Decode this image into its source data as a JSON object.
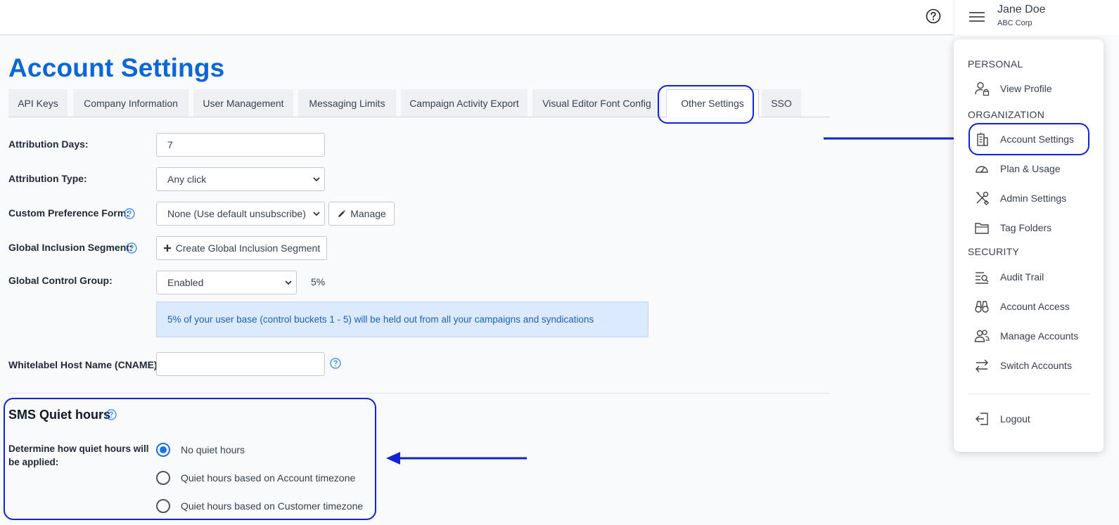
{
  "header": {
    "user_name": "Jane Doe",
    "user_org": "ABC Corp"
  },
  "page": {
    "title": "Account Settings"
  },
  "tabs": [
    {
      "label": "API Keys"
    },
    {
      "label": "Company Information"
    },
    {
      "label": "User Management"
    },
    {
      "label": "Messaging Limits"
    },
    {
      "label": "Campaign Activity Export"
    },
    {
      "label": "Visual Editor Font Config"
    },
    {
      "label": "Other Settings",
      "active": true
    },
    {
      "label": "SSO"
    }
  ],
  "form": {
    "attribution_days": {
      "label": "Attribution Days:",
      "value": "7"
    },
    "attribution_type": {
      "label": "Attribution Type:",
      "value": "Any click"
    },
    "custom_pref_form": {
      "label": "Custom Preference Form:",
      "value": "None (Use default unsubscribe)",
      "button": "Manage"
    },
    "global_inclusion": {
      "label": "Global Inclusion Segment:",
      "button": "Create Global Inclusion Segment"
    },
    "global_control": {
      "label": "Global Control Group:",
      "value": "Enabled",
      "percent": "5%"
    },
    "alert": "5% of your user base (control buckets 1 - 5) will be held out from all your campaigns and syndications",
    "whitelabel": {
      "label": "Whitelabel Host Name (CNAME):",
      "value": ""
    }
  },
  "sms": {
    "title": "SMS Quiet hours",
    "label": "Determine how quiet hours will be applied:",
    "options": [
      {
        "label": "No quiet hours",
        "selected": true
      },
      {
        "label": "Quiet hours based on Account timezone",
        "selected": false
      },
      {
        "label": "Quiet hours based on Customer timezone",
        "selected": false
      }
    ]
  },
  "dropdown": {
    "sections": {
      "personal": "PERSONAL",
      "organization": "ORGANIZATION",
      "security": "SECURITY"
    },
    "items": {
      "view_profile": "View Profile",
      "account_settings": "Account Settings",
      "plan_usage": "Plan & Usage",
      "admin_settings": "Admin Settings",
      "tag_folders": "Tag Folders",
      "audit_trail": "Audit Trail",
      "account_access": "Account Access",
      "manage_accounts": "Manage Accounts",
      "switch_accounts": "Switch Accounts",
      "logout": "Logout"
    }
  },
  "colors": {
    "brand_blue": "#0b66d8",
    "annotation_blue": "#1321d8",
    "alert_bg": "#dbeafe",
    "radio_selected": "#1d6fe0"
  }
}
